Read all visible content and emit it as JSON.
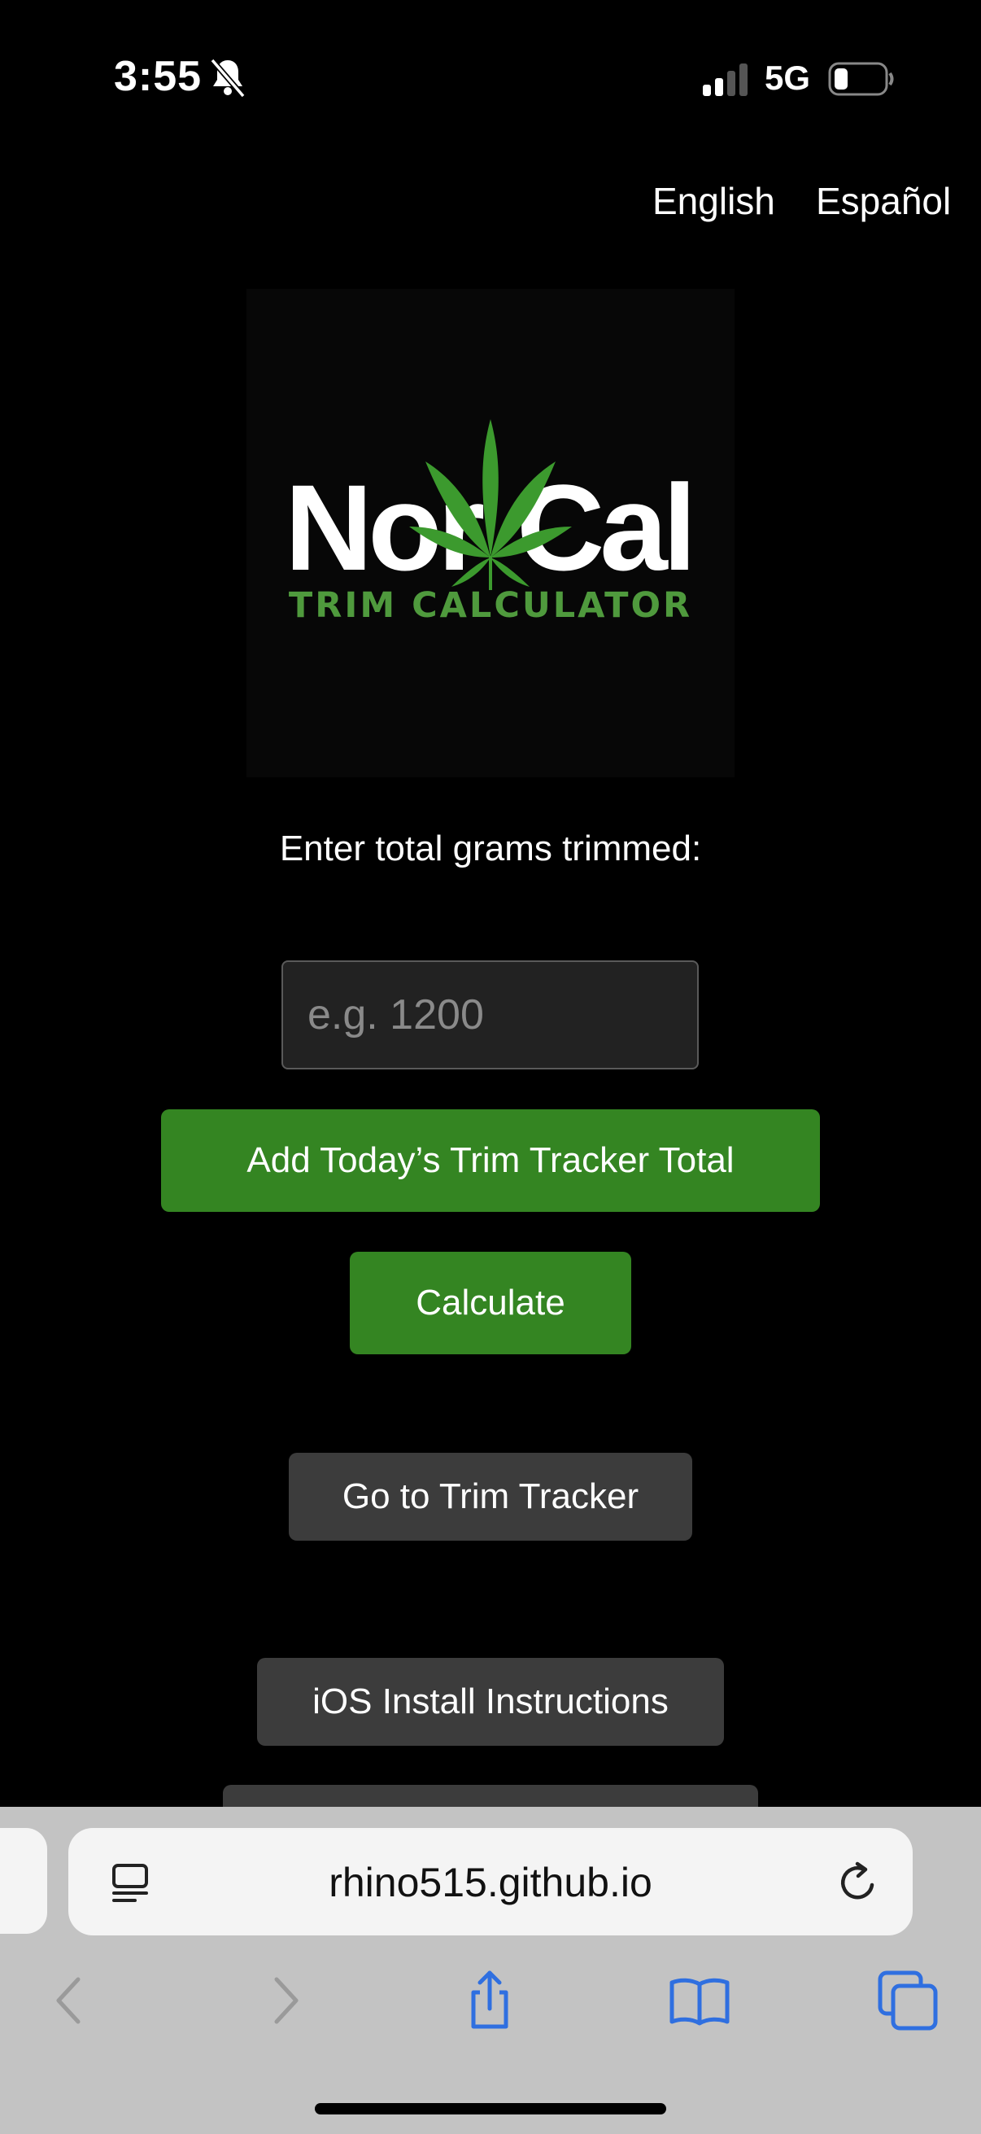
{
  "status_bar": {
    "time": "3:55",
    "network": "5G",
    "icons": [
      "bell-slash-icon",
      "signal-icon",
      "battery-icon"
    ]
  },
  "languages": {
    "english": "English",
    "spanish": "Español"
  },
  "logo": {
    "word_left": "Nor",
    "word_right": "Cal",
    "subtitle": "TRIM CALCULATOR",
    "leaf_color": "#3c9a2e",
    "subtitle_color": "#4f9a3d"
  },
  "form": {
    "prompt": "Enter total grams trimmed:",
    "input_placeholder": "e.g. 1200",
    "input_value": ""
  },
  "buttons": {
    "add_tracker": "Add Today’s Trim Tracker Total",
    "calculate": "Calculate",
    "go_tracker": "Go to Trim Tracker",
    "ios_install": "iOS Install Instructions"
  },
  "browser": {
    "url": "rhino515.github.io",
    "toolbar_icons": [
      "back-icon",
      "forward-icon",
      "share-icon",
      "bookmarks-icon",
      "tabs-icon"
    ]
  },
  "colors": {
    "primary_green": "#348522",
    "secondary_gray": "#3c3c3c",
    "link_blue": "#2f6fe0"
  }
}
